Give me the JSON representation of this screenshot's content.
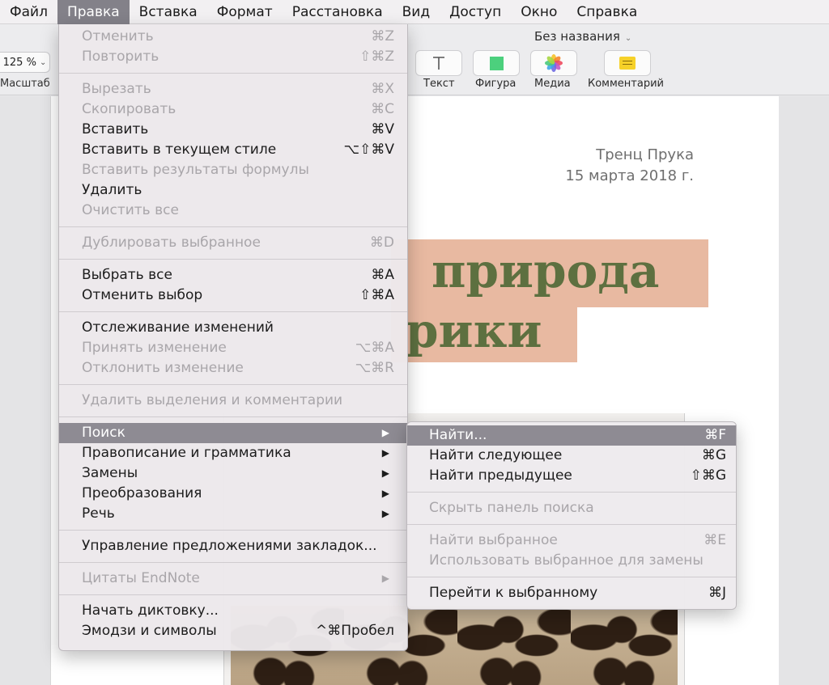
{
  "menubar": {
    "items": [
      {
        "label": "Файл"
      },
      {
        "label": "Правка",
        "active": true
      },
      {
        "label": "Вставка"
      },
      {
        "label": "Формат"
      },
      {
        "label": "Расстановка"
      },
      {
        "label": "Вид"
      },
      {
        "label": "Доступ"
      },
      {
        "label": "Окно"
      },
      {
        "label": "Справка"
      }
    ]
  },
  "toolbar": {
    "doc_title": "Без названия",
    "zoom_value": "125 %",
    "zoom_label": "Масштаб",
    "text_label": "Текст",
    "shape_label": "Фигура",
    "media_label": "Медиа",
    "comment_label": "Комментарий",
    "shape_color": "#4cd07d",
    "comment_color": "#f6d129"
  },
  "document": {
    "author": "Тренц Прука",
    "date": "15 марта 2018 г.",
    "title_line1": "природа",
    "title_line2": "рики",
    "title_color": "#5d7040",
    "highlight_color": "#e8b9a1"
  },
  "edit_menu": {
    "undo": {
      "label": "Отменить",
      "shortcut": "⌘Z"
    },
    "redo": {
      "label": "Повторить",
      "shortcut": "⇧⌘Z"
    },
    "cut": {
      "label": "Вырезать",
      "shortcut": "⌘X"
    },
    "copy": {
      "label": "Скопировать",
      "shortcut": "⌘C"
    },
    "paste": {
      "label": "Вставить",
      "shortcut": "⌘V"
    },
    "paste_style": {
      "label": "Вставить в текущем стиле",
      "shortcut": "⌥⇧⌘V"
    },
    "paste_formula": {
      "label": "Вставить результаты формулы"
    },
    "delete": {
      "label": "Удалить"
    },
    "clear_all": {
      "label": "Очистить все"
    },
    "duplicate": {
      "label": "Дублировать выбранное",
      "shortcut": "⌘D"
    },
    "select_all": {
      "label": "Выбрать все",
      "shortcut": "⌘A"
    },
    "deselect": {
      "label": "Отменить выбор",
      "shortcut": "⇧⌘A"
    },
    "track_changes": {
      "label": "Отслеживание изменений"
    },
    "accept_change": {
      "label": "Принять изменение",
      "shortcut": "⌥⌘A"
    },
    "reject_change": {
      "label": "Отклонить изменение",
      "shortcut": "⌥⌘R"
    },
    "remove_highlights": {
      "label": "Удалить выделения и комментарии"
    },
    "find": {
      "label": "Поиск"
    },
    "spelling": {
      "label": "Правописание и грамматика"
    },
    "substitutions": {
      "label": "Замены"
    },
    "transformations": {
      "label": "Преобразования"
    },
    "speech": {
      "label": "Речь"
    },
    "bookmarks": {
      "label": "Управление предложениями закладок..."
    },
    "endnote": {
      "label": "Цитаты EndNote"
    },
    "dictation": {
      "label": "Начать диктовку..."
    },
    "emoji": {
      "label": "Эмодзи и символы",
      "shortcut": "^⌘Пробел"
    }
  },
  "find_submenu": {
    "find": {
      "label": "Найти...",
      "shortcut": "⌘F"
    },
    "find_next": {
      "label": "Найти следующее",
      "shortcut": "⌘G"
    },
    "find_prev": {
      "label": "Найти предыдущее",
      "shortcut": "⇧⌘G"
    },
    "hide_find": {
      "label": "Скрыть панель поиска"
    },
    "use_selection": {
      "label": "Найти выбранное",
      "shortcut": "⌘E"
    },
    "use_selection_replace": {
      "label": "Использовать выбранное для замены"
    },
    "jump_to_selection": {
      "label": "Перейти к выбранному",
      "shortcut": "⌘J"
    }
  },
  "glyphs": {
    "submenu_arrow": "▶",
    "chevron": "⌄"
  }
}
